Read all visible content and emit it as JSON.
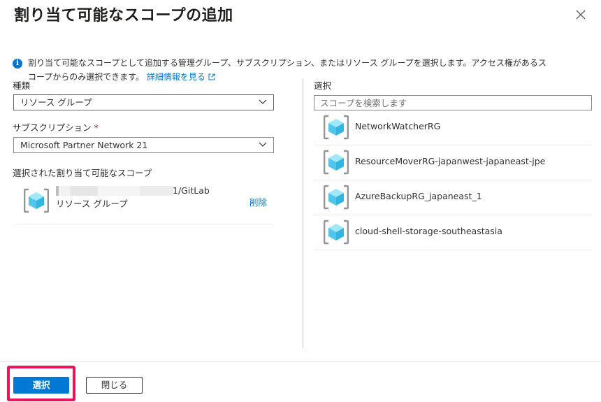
{
  "dialog": {
    "title": "割り当て可能なスコープの追加",
    "info_line1": "割り当て可能なスコープとして追加する管理グループ、サブスクリプション、またはリソース グループを選択します。アクセス権があるス",
    "info_line2": "コープからのみ選択できます。",
    "info_link": "詳細情報を見る"
  },
  "form": {
    "type_label": "種類",
    "type_value": "リソース グループ",
    "subscription_label": "サブスクリプション",
    "required_mark": "*",
    "subscription_value": "Microsoft Partner Network 21",
    "selected_label": "選択された割り当て可能なスコープ",
    "selected_scope_name": "1/GitLab",
    "selected_scope_type": "リソース グループ",
    "delete_label": "削除"
  },
  "picker": {
    "label": "選択",
    "search_placeholder": "スコープを検索します",
    "items": [
      {
        "label": "NetworkWatcherRG"
      },
      {
        "label": "ResourceMoverRG-japanwest-japaneast-jpe"
      },
      {
        "label": "AzureBackupRG_japaneast_1"
      },
      {
        "label": "cloud-shell-storage-southeastasia"
      }
    ]
  },
  "footer": {
    "select_button": "選択",
    "close_button": "閉じる"
  },
  "colors": {
    "accent": "#0078d4",
    "highlight": "#e8155d"
  },
  "icons": {
    "close": "close-icon",
    "info": "info-icon",
    "external": "external-link-icon",
    "resource_group": "resource-group-icon",
    "dropdown": "chevron-down-icon"
  }
}
